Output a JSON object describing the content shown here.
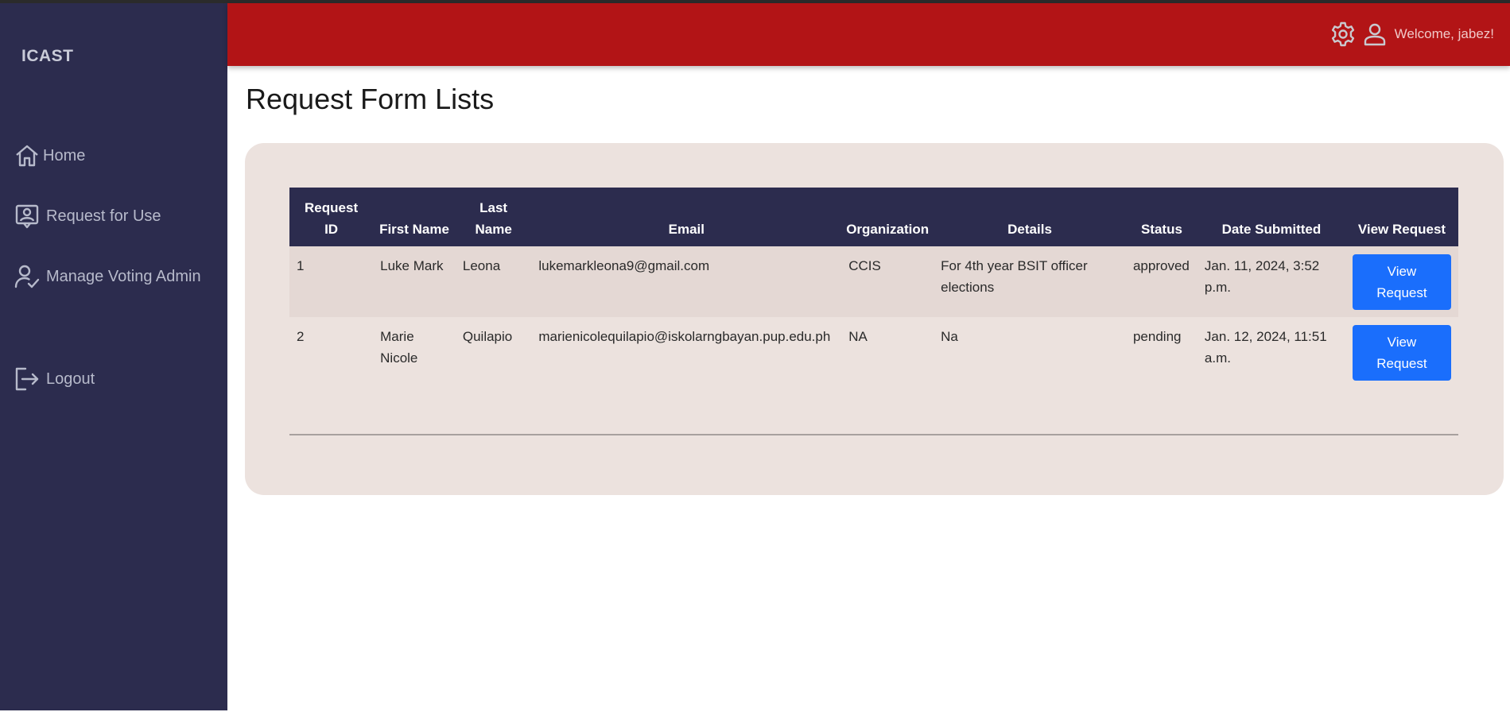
{
  "sidebar": {
    "brand": "ICAST",
    "items": [
      {
        "label": "Home",
        "icon": "home-icon"
      },
      {
        "label": "Request for Use",
        "icon": "id-card-icon"
      },
      {
        "label": "Manage Voting Admin",
        "icon": "user-check-icon"
      },
      {
        "label": "Logout",
        "icon": "logout-icon"
      }
    ]
  },
  "header": {
    "welcome": "Welcome, jabez!",
    "icons": [
      "gear-icon",
      "user-icon"
    ],
    "bar_color": "#b21416"
  },
  "main": {
    "title": "Request Form Lists",
    "table": {
      "columns": [
        "Request ID",
        "First Name",
        "Last Name",
        "Email",
        "Organization",
        "Details",
        "Status",
        "Date Submitted",
        "View Request"
      ],
      "rows": [
        {
          "request_id": "1",
          "first_name": "Luke Mark",
          "last_name": "Leona",
          "email": "lukemarkleona9@gmail.com",
          "organization": "CCIS",
          "details": "For 4th year BSIT officer elections",
          "status": "approved",
          "date_submitted": "Jan. 11, 2024, 3:52 p.m.",
          "button": "View Request"
        },
        {
          "request_id": "2",
          "first_name": "Marie Nicole",
          "last_name": "Quilapio",
          "email": "marienicolequilapio@iskolarngbayan.pup.edu.ph",
          "organization": "NA",
          "details": "Na",
          "status": "pending",
          "date_submitted": "Jan. 12, 2024, 11:51 a.m.",
          "button": "View Request"
        }
      ]
    }
  },
  "colors": {
    "sidebar": "#2c2c4e",
    "accent_button": "#1a6efc",
    "panel": "#ece2de"
  }
}
